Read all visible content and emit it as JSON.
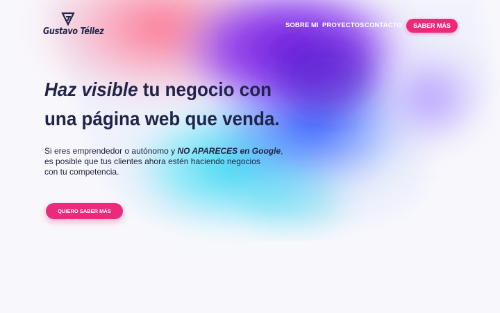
{
  "brand": {
    "name": "Gustavo Téllez",
    "logo_icon": "gt-monogram-icon",
    "logo_color": "#23264a"
  },
  "nav": {
    "items": [
      {
        "label": "SOBRE MI"
      },
      {
        "label": "PROYECTOS"
      },
      {
        "label": "CONTACTO"
      }
    ],
    "cta_label": "SABER MÁS"
  },
  "hero": {
    "title_highlight": "Haz visible",
    "title_rest": " tu negocio con",
    "title_line2": "una página web que venda.",
    "text_before": "Si eres emprendedor o autónomo y ",
    "text_strong": "NO APARECES en Google",
    "text_after": ",",
    "text_line2": "es posible que tus clientes ahora estén haciendo negocios",
    "text_line3": "con tu competencia.",
    "cta_label": "QUIERO SABER MÁS"
  },
  "colors": {
    "accent": "#f0287a",
    "text_dark": "#21244a",
    "background": "#f8f8fc",
    "gradient": [
      "#ff6b8a",
      "#8b2cf0",
      "#4a2bd6",
      "#2f6bff",
      "#3ed8f0",
      "#b48cff"
    ]
  }
}
